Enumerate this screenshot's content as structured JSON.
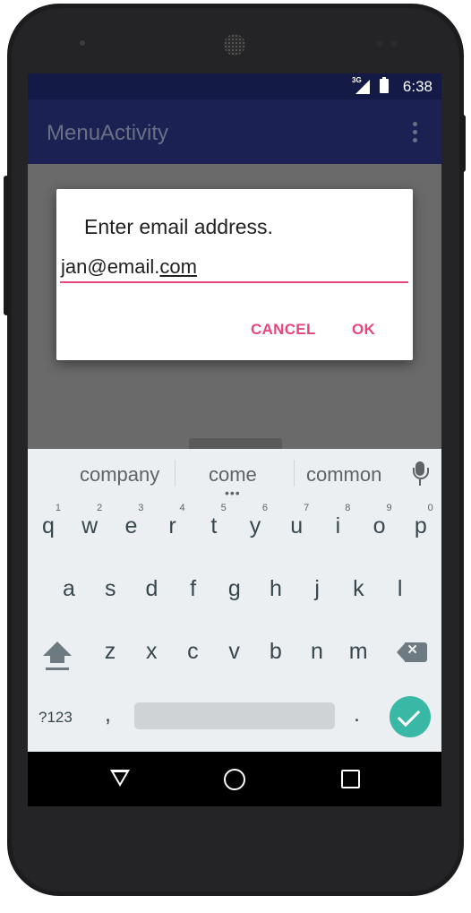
{
  "status_bar": {
    "network": "3G",
    "time": "6:38"
  },
  "app_bar": {
    "title": "MenuActivity",
    "overflow_icon": "more-vert-icon"
  },
  "dialog": {
    "title": "Enter email address.",
    "email_prefix": "jan@email.",
    "email_composing": "com",
    "cancel_label": "CANCEL",
    "ok_label": "OK",
    "accent_color": "#e8457e"
  },
  "keyboard": {
    "suggestions": [
      "company",
      "come",
      "common"
    ],
    "row1": [
      {
        "ch": "q",
        "hint": "1"
      },
      {
        "ch": "w",
        "hint": "2"
      },
      {
        "ch": "e",
        "hint": "3"
      },
      {
        "ch": "r",
        "hint": "4"
      },
      {
        "ch": "t",
        "hint": "5"
      },
      {
        "ch": "y",
        "hint": "6"
      },
      {
        "ch": "u",
        "hint": "7"
      },
      {
        "ch": "i",
        "hint": "8"
      },
      {
        "ch": "o",
        "hint": "9"
      },
      {
        "ch": "p",
        "hint": "0"
      }
    ],
    "row2": [
      "a",
      "s",
      "d",
      "f",
      "g",
      "h",
      "j",
      "k",
      "l"
    ],
    "row3": [
      "z",
      "x",
      "c",
      "v",
      "b",
      "n",
      "m"
    ],
    "symbols_label": "?123",
    "comma": ",",
    "period": ".",
    "done_color": "#3ab8a6"
  },
  "nav_bar": {
    "back_icon": "back-icon",
    "home_icon": "home-icon",
    "recents_icon": "recents-icon"
  }
}
